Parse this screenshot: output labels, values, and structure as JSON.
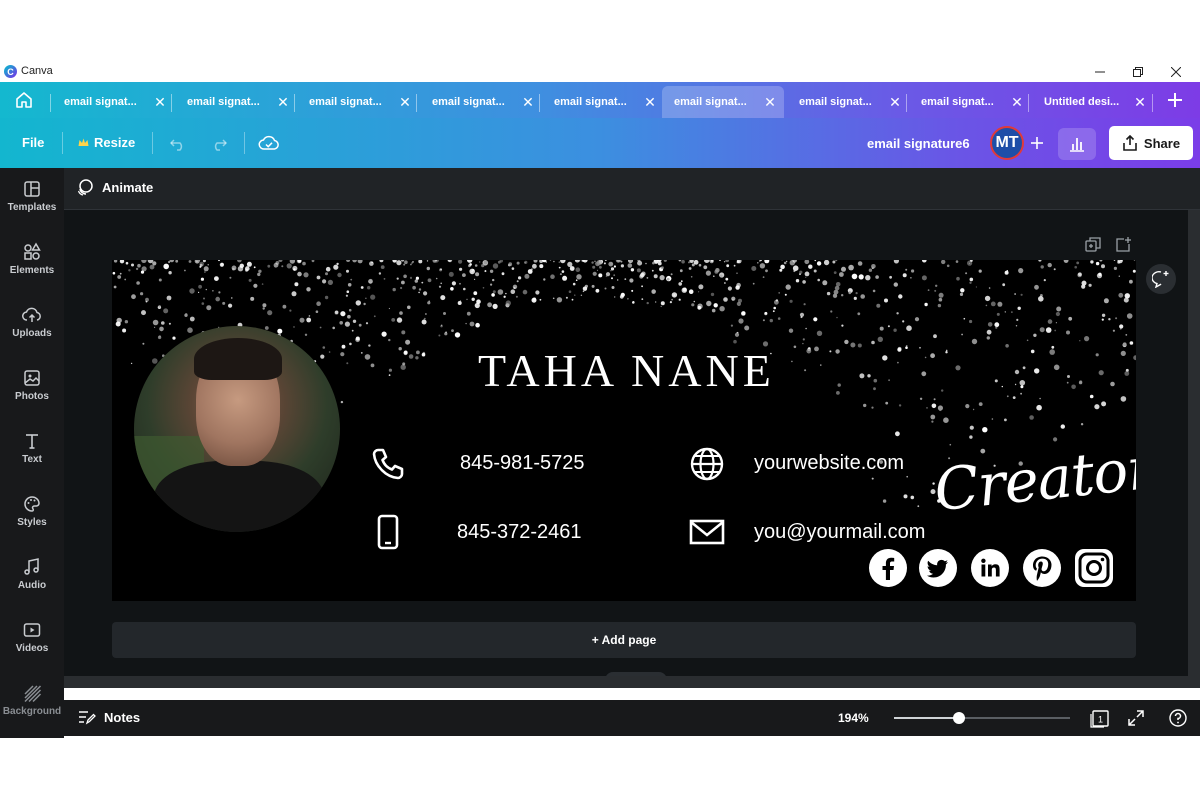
{
  "window": {
    "app_name": "Canva",
    "logo_letter": "C"
  },
  "tabs": [
    {
      "label": "email signat...",
      "active": false
    },
    {
      "label": "email signat...",
      "active": false
    },
    {
      "label": "email signat...",
      "active": false
    },
    {
      "label": "email signat...",
      "active": false
    },
    {
      "label": "email signat...",
      "active": false
    },
    {
      "label": "email signat...",
      "active": true
    },
    {
      "label": "email signat...",
      "active": false
    },
    {
      "label": "email signat...",
      "active": false
    },
    {
      "label": "Untitled desi...",
      "active": false
    }
  ],
  "toolbar": {
    "file_label": "File",
    "resize_label": "Resize",
    "design_name": "email signature6",
    "avatar_initials": "MT",
    "share_label": "Share"
  },
  "sidebar": {
    "items": [
      {
        "label": "Templates",
        "icon": "templates-icon"
      },
      {
        "label": "Elements",
        "icon": "elements-icon"
      },
      {
        "label": "Uploads",
        "icon": "uploads-icon"
      },
      {
        "label": "Photos",
        "icon": "photos-icon"
      },
      {
        "label": "Text",
        "icon": "text-icon"
      },
      {
        "label": "Styles",
        "icon": "styles-icon"
      },
      {
        "label": "Audio",
        "icon": "audio-icon"
      },
      {
        "label": "Videos",
        "icon": "videos-icon"
      },
      {
        "label": "Background",
        "icon": "background-icon"
      }
    ]
  },
  "canvas": {
    "animate_label": "Animate",
    "add_page_label": "+ Add page"
  },
  "design": {
    "name": "TAHA NANE",
    "phone1": "845-981-5725",
    "phone2": "845-372-2461",
    "website": "yourwebsite.com",
    "email": "you@yourmail.com",
    "tagline": "Creator"
  },
  "bottom": {
    "notes_label": "Notes",
    "zoom_label": "194%",
    "zoom_fraction": 0.37
  },
  "colors": {
    "accent_start": "#13b6cf",
    "accent_end": "#7b3de8",
    "panel": "#18191b",
    "canvas_bg": "#111416"
  }
}
